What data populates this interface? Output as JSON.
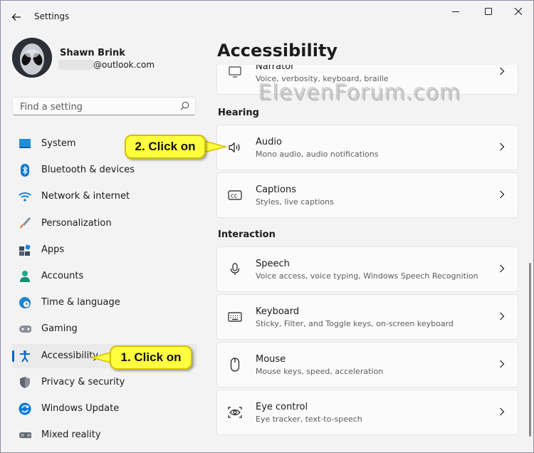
{
  "titlebar": {
    "title": "Settings",
    "back_icon": "back-arrow-icon",
    "minimize_icon": "minimize-icon",
    "maximize_icon": "maximize-icon",
    "close_icon": "close-icon"
  },
  "user": {
    "name": "Shawn Brink",
    "email_visible": "@outlook.com"
  },
  "search": {
    "placeholder": "Find a setting",
    "icon": "search-icon"
  },
  "nav": {
    "items": [
      {
        "label": "System",
        "icon": "system-icon",
        "selected": false
      },
      {
        "label": "Bluetooth & devices",
        "icon": "bluetooth-icon",
        "selected": false
      },
      {
        "label": "Network & internet",
        "icon": "wifi-icon",
        "selected": false
      },
      {
        "label": "Personalization",
        "icon": "brush-icon",
        "selected": false
      },
      {
        "label": "Apps",
        "icon": "apps-icon",
        "selected": false
      },
      {
        "label": "Accounts",
        "icon": "accounts-icon",
        "selected": false
      },
      {
        "label": "Time & language",
        "icon": "globe-clock-icon",
        "selected": false
      },
      {
        "label": "Gaming",
        "icon": "gamepad-icon",
        "selected": false
      },
      {
        "label": "Accessibility",
        "icon": "accessibility-icon",
        "selected": true
      },
      {
        "label": "Privacy & security",
        "icon": "shield-icon",
        "selected": false
      },
      {
        "label": "Windows Update",
        "icon": "update-icon",
        "selected": false
      },
      {
        "label": "Mixed reality",
        "icon": "headset-icon",
        "selected": false
      }
    ]
  },
  "main": {
    "page_title": "Accessibility",
    "partial_card": {
      "title": "Narrator",
      "subtitle": "Voice, verbosity, keyboard, braille"
    },
    "sections": [
      {
        "label": "Hearing",
        "cards": [
          {
            "title": "Audio",
            "subtitle": "Mono audio, audio notifications",
            "icon": "speaker-icon"
          },
          {
            "title": "Captions",
            "subtitle": "Styles, live captions",
            "icon": "captions-icon"
          }
        ]
      },
      {
        "label": "Interaction",
        "cards": [
          {
            "title": "Speech",
            "subtitle": "Voice access, voice typing, Windows Speech Recognition",
            "icon": "microphone-icon"
          },
          {
            "title": "Keyboard",
            "subtitle": "Sticky, Filter, and Toggle keys, on-screen keyboard",
            "icon": "keyboard-icon"
          },
          {
            "title": "Mouse",
            "subtitle": "Mouse keys, speed, acceleration",
            "icon": "mouse-icon"
          },
          {
            "title": "Eye control",
            "subtitle": "Eye tracker, text-to-speech",
            "icon": "eye-control-icon"
          }
        ]
      }
    ]
  },
  "watermark": "ElevenForum.com",
  "callouts": {
    "step1": "1. Click on",
    "step2": "2. Click on"
  },
  "colors": {
    "accent": "#0067c0",
    "callout_fill": "#ffff40",
    "window_bg": "#f3f3f3",
    "card_bg": "#fbfbfb"
  }
}
